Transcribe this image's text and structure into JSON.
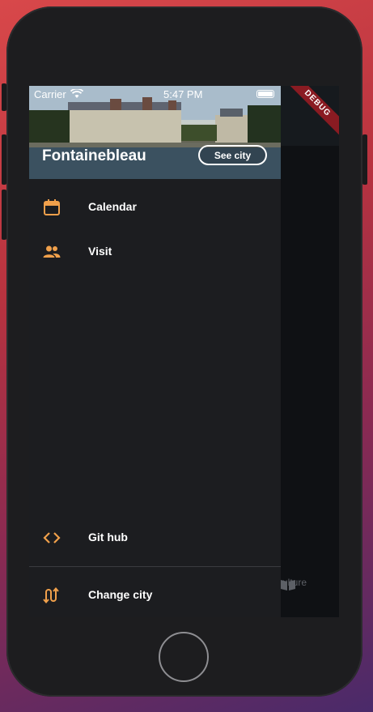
{
  "status_bar": {
    "carrier": "Carrier",
    "time": "5:47 PM"
  },
  "debug_banner": "DEBUG",
  "drawer": {
    "header": {
      "city": "Fontainebleau",
      "see_city_label": "See city"
    },
    "items": [
      {
        "label": "Calendar",
        "icon": "calendar-icon"
      },
      {
        "label": "Visit",
        "icon": "people-icon"
      }
    ],
    "bottom_items": [
      {
        "label": "Git hub",
        "icon": "code-icon"
      },
      {
        "label": "Change city",
        "icon": "swap-icon"
      }
    ]
  },
  "background_app": {
    "tab_label": "ulture"
  },
  "colors": {
    "accent": "#f0a04b",
    "drawer_bg": "#1c1d20",
    "text": "#ffffff"
  }
}
